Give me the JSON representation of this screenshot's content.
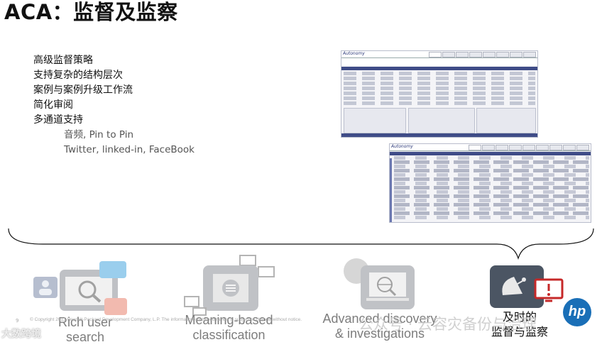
{
  "title": "ACA：监督及监察",
  "bullets": [
    {
      "text": "高级监督策略",
      "level": 1
    },
    {
      "text": "支持复杂的结构层次",
      "level": 1
    },
    {
      "text": "案例与案例升级工作流",
      "level": 1
    },
    {
      "text": "简化审阅",
      "level": 1
    },
    {
      "text": "多通道支持",
      "level": 1
    },
    {
      "text": "音频, Pin to Pin",
      "level": 2
    },
    {
      "text": "Twitter, linked-in, FaceBook",
      "level": 2
    }
  ],
  "screenshots": {
    "top_app": "Autonomy",
    "bottom_app": "Autonomy"
  },
  "features": [
    {
      "line1": "Rich user",
      "line2": "search",
      "icon": "magnifier-user-icon",
      "highlighted": false
    },
    {
      "line1": "Meaning-based",
      "line2": "classification",
      "icon": "hierarchy-document-icon",
      "highlighted": false
    },
    {
      "line1": "Advanced discovery",
      "line2": "& investigations",
      "icon": "globe-laptop-icon",
      "highlighted": false
    },
    {
      "line1": "及时的",
      "line2": "监督与监察",
      "icon": "satellite-dish-alert-icon",
      "highlighted": true
    }
  ],
  "footer": {
    "page_number": "9",
    "copyright": "© Copyright 2012 Hewlett-Packard Development Company, L.P. The information contained herein is subject to change without notice.",
    "watermark_left": "大数跨境",
    "watermark_right": "公众号 · 云容灾备份与治理",
    "logo": "hp"
  },
  "colors": {
    "accent": "#3f4c87",
    "highlight_box": "#4b5563",
    "faded_box": "#9aa0aa",
    "hp_blue": "#1a6fb7"
  }
}
